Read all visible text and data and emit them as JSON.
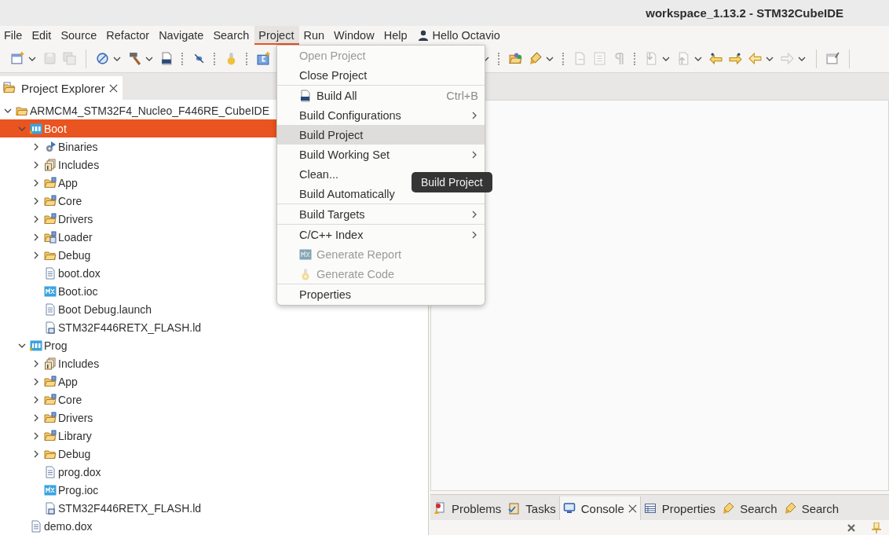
{
  "window": {
    "title": "workspace_1.13.2 - STM32CubeIDE"
  },
  "menubar": {
    "items": [
      {
        "label": "File",
        "selected": false
      },
      {
        "label": "Edit",
        "selected": false
      },
      {
        "label": "Source",
        "selected": false
      },
      {
        "label": "Refactor",
        "selected": false
      },
      {
        "label": "Navigate",
        "selected": false
      },
      {
        "label": "Search",
        "selected": false
      },
      {
        "label": "Project",
        "selected": true
      },
      {
        "label": "Run",
        "selected": false
      },
      {
        "label": "Window",
        "selected": false
      },
      {
        "label": "Help",
        "selected": false
      }
    ],
    "user_label": "Hello Octavio"
  },
  "explorer": {
    "tab": {
      "label": "Project Explorer",
      "selected": true,
      "closable": true
    },
    "tree": [
      {
        "label": "ARMCM4_STM32F4_Nucleo_F446RE_CubeIDE",
        "kind": "project",
        "expanded": true,
        "selected": false,
        "children": [
          {
            "label": "Boot",
            "kind": "ide",
            "expanded": true,
            "selected": true,
            "children": [
              {
                "label": "Binaries",
                "kind": "binaries",
                "expanded": false,
                "selected": false
              },
              {
                "label": "Includes",
                "kind": "includes",
                "expanded": false,
                "selected": false
              },
              {
                "label": "App",
                "kind": "srcfolder",
                "expanded": false,
                "selected": false
              },
              {
                "label": "Core",
                "kind": "srcfolder",
                "expanded": false,
                "selected": false
              },
              {
                "label": "Drivers",
                "kind": "srcfolder",
                "expanded": false,
                "selected": false
              },
              {
                "label": "Loader",
                "kind": "loaderfolder",
                "expanded": false,
                "selected": false
              },
              {
                "label": "Debug",
                "kind": "folder",
                "expanded": false,
                "selected": false
              },
              {
                "label": "boot.dox",
                "kind": "file",
                "selected": false
              },
              {
                "label": "Boot.ioc",
                "kind": "mx",
                "selected": false
              },
              {
                "label": "Boot Debug.launch",
                "kind": "file",
                "selected": false
              },
              {
                "label": "STM32F446RETX_FLASH.ld",
                "kind": "ld",
                "selected": false
              }
            ]
          },
          {
            "label": "Prog",
            "kind": "ide",
            "expanded": true,
            "selected": false,
            "children": [
              {
                "label": "Includes",
                "kind": "includes",
                "expanded": false,
                "selected": false
              },
              {
                "label": "App",
                "kind": "srcfolder",
                "expanded": false,
                "selected": false
              },
              {
                "label": "Core",
                "kind": "srcfolder",
                "expanded": false,
                "selected": false
              },
              {
                "label": "Drivers",
                "kind": "srcfolder",
                "expanded": false,
                "selected": false
              },
              {
                "label": "Library",
                "kind": "srcfolder",
                "expanded": false,
                "selected": false
              },
              {
                "label": "Debug",
                "kind": "folder",
                "expanded": false,
                "selected": false
              },
              {
                "label": "prog.dox",
                "kind": "file",
                "selected": false
              },
              {
                "label": "Prog.ioc",
                "kind": "mx",
                "selected": false
              },
              {
                "label": "STM32F446RETX_FLASH.ld",
                "kind": "ld",
                "selected": false
              }
            ]
          },
          {
            "label": "demo.dox",
            "kind": "file",
            "selected": false
          }
        ]
      }
    ]
  },
  "bottom_panel": {
    "tabs": [
      {
        "label": "Problems",
        "kind": "problems",
        "selected": false,
        "closable": false
      },
      {
        "label": "Tasks",
        "kind": "tasks",
        "selected": false,
        "closable": false
      },
      {
        "label": "Console",
        "kind": "console",
        "selected": true,
        "closable": true
      },
      {
        "label": "Properties",
        "kind": "properties",
        "selected": false,
        "closable": false
      },
      {
        "label": "Search",
        "kind": "search",
        "selected": false,
        "closable": false
      },
      {
        "label": "Search",
        "kind": "search",
        "selected": false,
        "closable": false
      }
    ]
  },
  "project_menu": {
    "items": [
      {
        "kind": "item",
        "label": "Open Project",
        "disabled": true,
        "selected": false,
        "submenu": false
      },
      {
        "kind": "item",
        "label": "Close Project",
        "disabled": false,
        "selected": false,
        "submenu": false
      },
      {
        "kind": "separator"
      },
      {
        "kind": "item_binary",
        "label": "Build All",
        "shortcut": "Ctrl+B",
        "disabled": false,
        "selected": false,
        "submenu": false
      },
      {
        "kind": "item",
        "label": "Build Configurations",
        "disabled": false,
        "selected": false,
        "submenu": true
      },
      {
        "kind": "item",
        "label": "Build Project",
        "disabled": false,
        "selected": true,
        "submenu": false
      },
      {
        "kind": "item",
        "label": "Build Working Set",
        "disabled": false,
        "selected": false,
        "submenu": true
      },
      {
        "kind": "item",
        "label": "Clean...",
        "disabled": false,
        "selected": false,
        "submenu": false
      },
      {
        "kind": "item",
        "label": "Build Automatically",
        "disabled": false,
        "selected": false,
        "submenu": false
      },
      {
        "kind": "separator"
      },
      {
        "kind": "item",
        "label": "Build Targets",
        "disabled": false,
        "selected": false,
        "submenu": true
      },
      {
        "kind": "separator"
      },
      {
        "kind": "item",
        "label": "C/C++ Index",
        "disabled": false,
        "selected": false,
        "submenu": true
      },
      {
        "kind": "item_mx",
        "label": "Generate Report",
        "disabled": true,
        "selected": false,
        "submenu": false
      },
      {
        "kind": "item_gear",
        "label": "Generate Code",
        "disabled": true,
        "selected": false,
        "submenu": false
      },
      {
        "kind": "separator"
      },
      {
        "kind": "item",
        "label": "Properties",
        "disabled": false,
        "selected": false,
        "submenu": false
      }
    ],
    "tooltip": "Build Project"
  }
}
